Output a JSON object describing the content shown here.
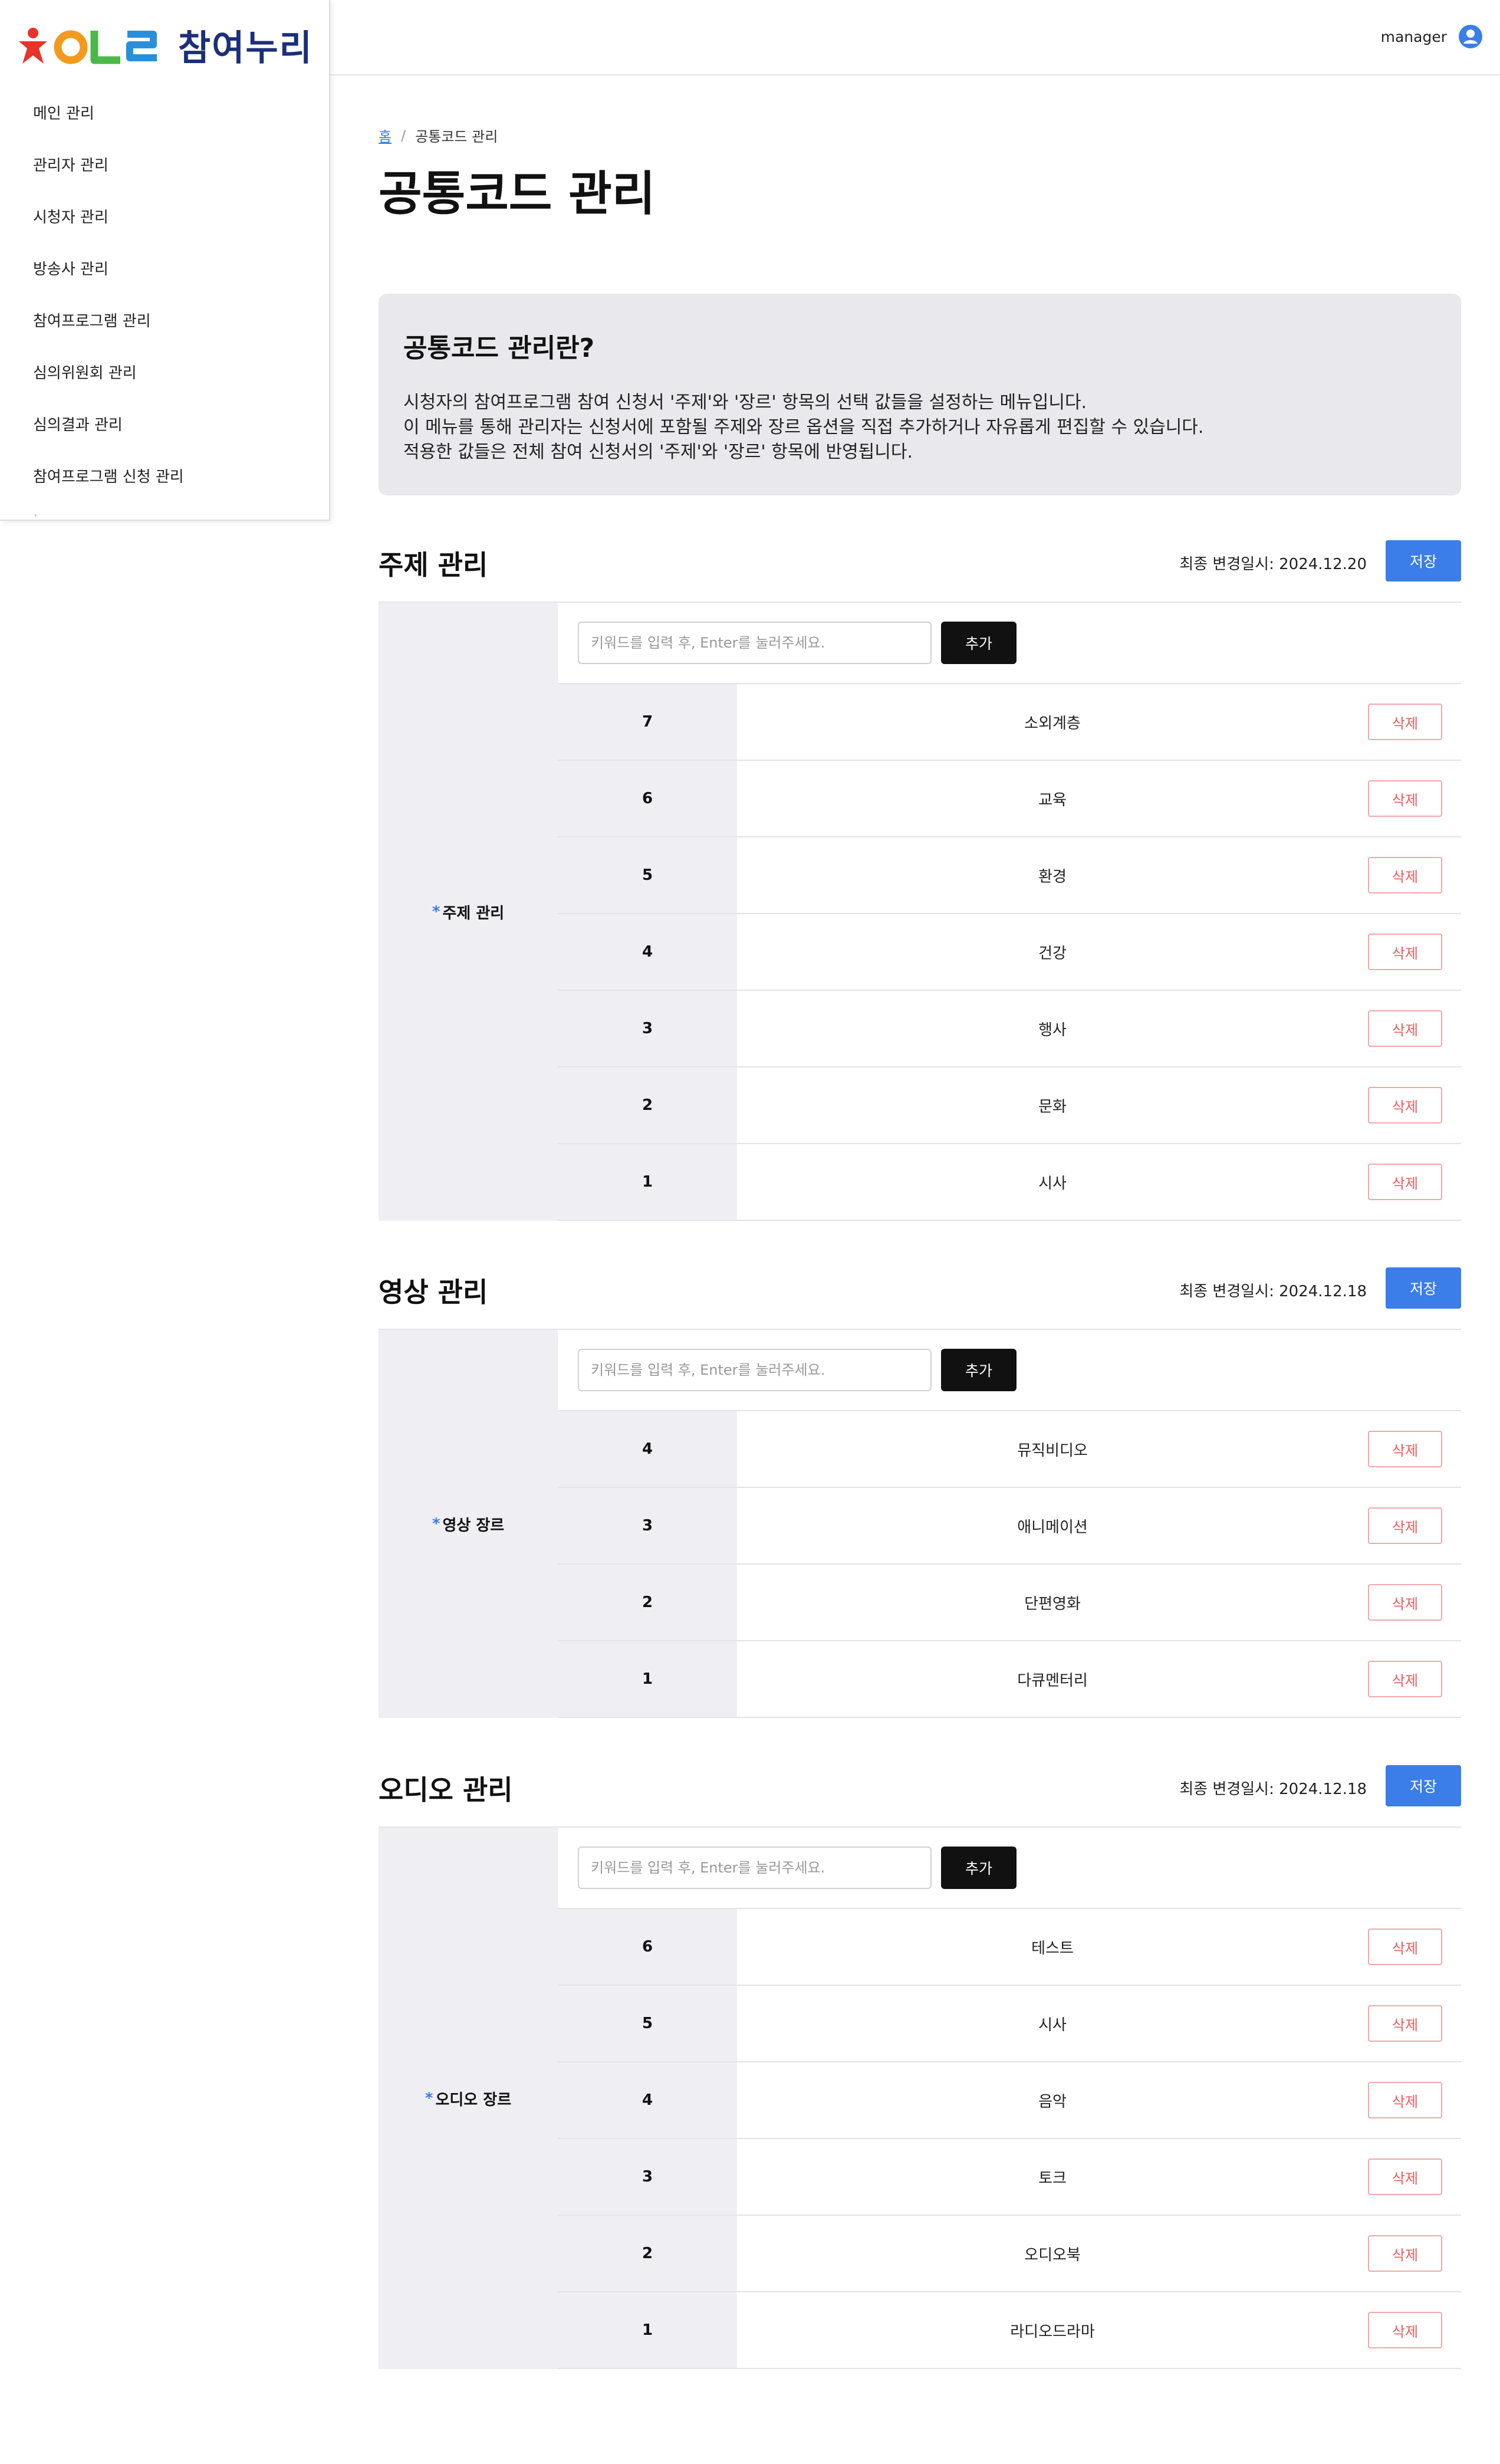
{
  "brand": {
    "name": "참여누리",
    "logo_letters": "아이엘",
    "colors": {
      "red": "#e8332b",
      "orange": "#f39a1d",
      "green": "#4cb848",
      "blue": "#2a8fd8",
      "navy": "#1b2f7a"
    }
  },
  "sidebar": {
    "items": [
      {
        "label": "메인 관리"
      },
      {
        "label": "관리자 관리"
      },
      {
        "label": "시청자 관리"
      },
      {
        "label": "방송사 관리"
      },
      {
        "label": "참여프로그램 관리"
      },
      {
        "label": "심의위원회 관리"
      },
      {
        "label": "심의결과 관리"
      },
      {
        "label": "참여프로그램 신청 관리"
      }
    ]
  },
  "header": {
    "user_name": "manager",
    "user_icon": "user-circle-icon"
  },
  "breadcrumb": {
    "home": "홈",
    "separator": "/",
    "current": "공통코드 관리"
  },
  "page_title": "공통코드 관리",
  "info": {
    "title": "공통코드 관리란?",
    "lines": [
      "시청자의 참여프로그램 참여 신청서 '주제'와 '장르' 항목의 선택 값들을 설정하는 메뉴입니다.",
      "이 메뉴를 통해 관리자는 신청서에 포함될 주제와 장르 옵션을 직접 추가하거나 자유롭게 편집할 수 있습니다.",
      "적용한 값들은 전체 참여 신청서의 '주제'와 '장르' 항목에 반영됩니다."
    ]
  },
  "common": {
    "placeholder": "키워드를 입력 후, Enter를 눌러주세요.",
    "add_label": "추가",
    "delete_label": "삭제",
    "save_label": "저장",
    "required_mark": "*"
  },
  "sections": [
    {
      "title": "주제 관리",
      "updated": "최종 변경일시: 2024.12.20",
      "label": "주제 관리",
      "rows": [
        {
          "num": "7",
          "name": "소외계층"
        },
        {
          "num": "6",
          "name": "교육"
        },
        {
          "num": "5",
          "name": "환경"
        },
        {
          "num": "4",
          "name": "건강"
        },
        {
          "num": "3",
          "name": "행사"
        },
        {
          "num": "2",
          "name": "문화"
        },
        {
          "num": "1",
          "name": "시사"
        }
      ]
    },
    {
      "title": "영상 관리",
      "updated": "최종 변경일시: 2024.12.18",
      "label": "영상 장르",
      "rows": [
        {
          "num": "4",
          "name": "뮤직비디오"
        },
        {
          "num": "3",
          "name": "애니메이션"
        },
        {
          "num": "2",
          "name": "단편영화"
        },
        {
          "num": "1",
          "name": "다큐멘터리"
        }
      ]
    },
    {
      "title": "오디오 관리",
      "updated": "최종 변경일시: 2024.12.18",
      "label": "오디오 장르",
      "rows": [
        {
          "num": "6",
          "name": "테스트"
        },
        {
          "num": "5",
          "name": "시사"
        },
        {
          "num": "4",
          "name": "음악"
        },
        {
          "num": "3",
          "name": "토크"
        },
        {
          "num": "2",
          "name": "오디오북"
        },
        {
          "num": "1",
          "name": "라디오드라마"
        }
      ]
    }
  ]
}
